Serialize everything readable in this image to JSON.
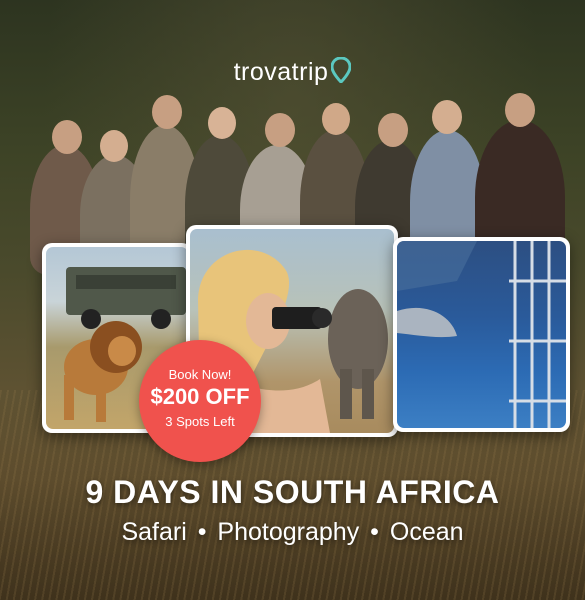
{
  "brand": {
    "name": "trovatrip",
    "accent": "#5bc8c0",
    "icon": "location-pin-icon"
  },
  "badge": {
    "line1": "Book Now!",
    "line2": "$200 OFF",
    "line3": "3 Spots Left",
    "color": "#f0524d"
  },
  "headline": "9 DAYS IN SOUTH AFRICA",
  "tags": {
    "item1": "Safari",
    "sep1": "•",
    "item2": "Photography",
    "sep2": "•",
    "item3": "Ocean"
  },
  "photos": [
    {
      "subject": "lion-and-safari-truck"
    },
    {
      "subject": "photographer-and-elephant"
    },
    {
      "subject": "shark-and-cage"
    }
  ]
}
